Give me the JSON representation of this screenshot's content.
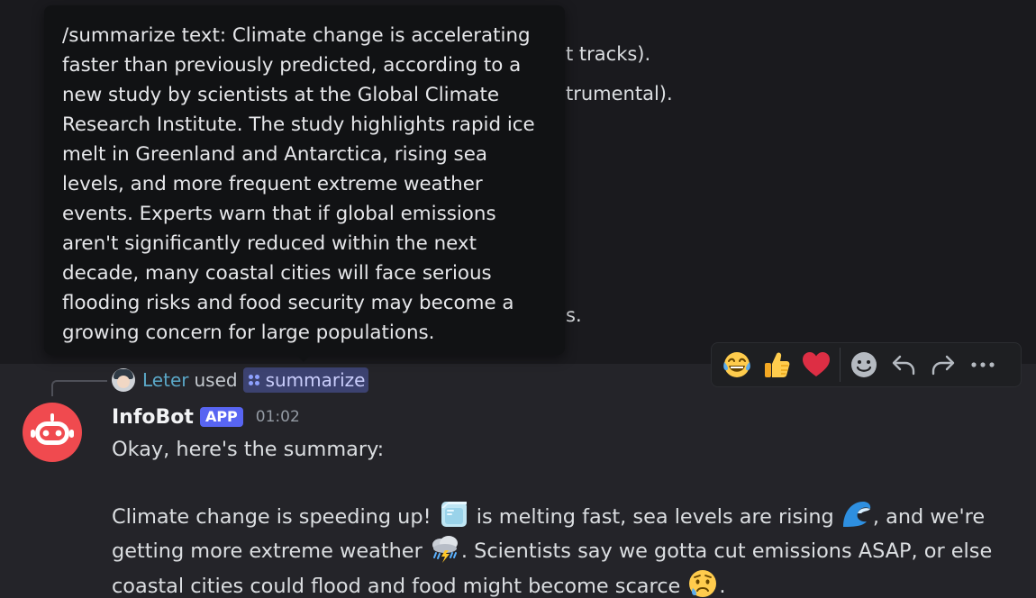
{
  "previous_message": {
    "line1_fragment": "t tracks).",
    "line2_fragment": "trumental).",
    "line3_fragment": "s."
  },
  "tooltip": {
    "text": "/summarize text: Climate change is accelerating faster than previously predicted, according to a new study by scientists at the Global Climate Research Institute. The study highlights rapid ice melt in Greenland and Antarctica, rising sea levels, and more frequent extreme weather events. Experts warn that if global emissions aren't significantly reduced within the next decade, many coastal cities will face serious flooding risks and food security may become a growing concern for large populations."
  },
  "reply": {
    "user": "Leter",
    "used_label": "used",
    "command": "summarize"
  },
  "message": {
    "author": "InfoBot",
    "badge": "APP",
    "timestamp": "01:02",
    "intro": "Okay, here's the summary:",
    "body": {
      "part1": "Climate change is speeding up! ",
      "part2": " is melting fast, sea levels are rising ",
      "part3": ", and we're getting more extreme weather ",
      "part4": ". Scientists say we gotta cut emissions ASAP, or else coastal cities could flood and food might become scarce ",
      "part5": "."
    },
    "emojis": [
      "ice-cube-icon",
      "wave-icon",
      "storm-cloud-icon",
      "sad-face-icon"
    ]
  },
  "toolbar": {
    "reactions": [
      "joy-emoji",
      "thumbs-up-emoji",
      "heart-emoji"
    ],
    "actions": [
      "add-reaction-icon",
      "reply-icon",
      "forward-icon",
      "more-icon"
    ]
  },
  "colors": {
    "background": "#1a1a1e",
    "message_highlight": "#242429",
    "tooltip_bg": "#111214",
    "app_badge": "#5865f2",
    "username_link": "#5aa7c7",
    "command_pill": "#3c4270",
    "bot_avatar": "#f04a4f"
  }
}
